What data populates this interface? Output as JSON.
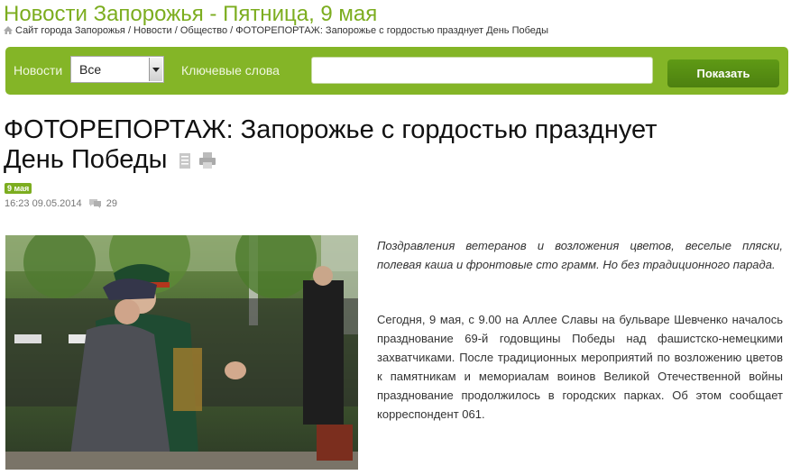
{
  "header": {
    "title": "Новости Запорожья - Пятница, 9 мая"
  },
  "breadcrumb": {
    "items": [
      "Сайт города Запорожья",
      "Новости",
      "Общество",
      "ФОТОРЕПОРТАЖ: Запорожье с гордостью празднует День Победы"
    ],
    "separator": " / "
  },
  "filter": {
    "news_label": "Новости",
    "category_value": "Все",
    "keywords_label": "Ключевые слова",
    "keywords_value": "",
    "submit_label": "Показать"
  },
  "article": {
    "title_line1": "ФОТОРЕПОРТАЖ: Запорожье с гордостью празднует",
    "title_line2": "День Победы",
    "date_badge": "9 мая",
    "time": "16:23",
    "date": "09.05.2014",
    "comments": "29",
    "lead": "Поздравления ветеранов и возложения цветов, веселые пляски, полевая каша и фронтовые сто грамм. Но без традиционного парада.",
    "body": "Сегодня, 9 мая, с 9.00 на Аллее Славы на бульваре Шевченко началось празднование 69-й годовщины Победы над фашистско-немецкими захватчиками. После традиционных мероприятий по возложению цветов к памятникам и мемориалам воинов Великой Отечественной войны празднование продолжилось в городских парках. Об этом сообщает корреспондент 061."
  },
  "icons": [
    "home-icon",
    "chevron-down-icon",
    "document-icon",
    "print-icon",
    "comment-icon"
  ],
  "colors": {
    "accent": "#84b527",
    "title_green": "#7cad1f",
    "button": "#5a9214"
  }
}
